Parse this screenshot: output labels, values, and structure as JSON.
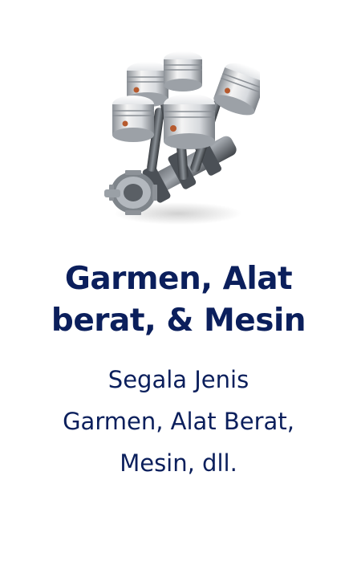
{
  "card": {
    "image": {
      "icon": "engine-pistons-icon",
      "alt": ""
    },
    "title_lines": [
      "Garmen, Alat",
      "berat, & Mesin"
    ],
    "description_lines": [
      "Segala Jenis",
      "Garmen, Alat Berat,",
      "Mesin, dll."
    ]
  },
  "colors": {
    "title": "#0b1f5c",
    "description": "#0b1f5c",
    "background": "#ffffff",
    "metal_light": "#eeeeee",
    "metal_mid": "#b9bec4",
    "metal_dark": "#4a4f55",
    "accent_copper": "#b65a2e"
  }
}
